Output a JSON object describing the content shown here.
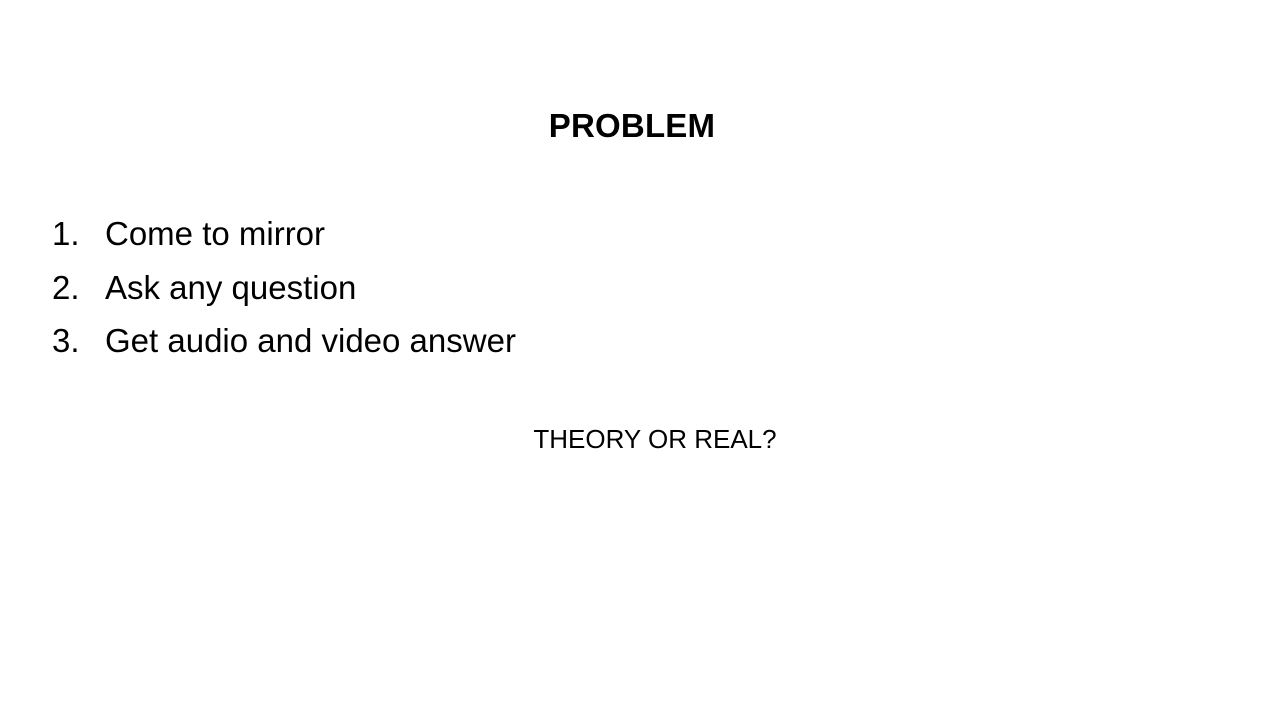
{
  "slide": {
    "title": "PROBLEM",
    "steps": [
      {
        "number": "1.",
        "text": "Come to mirror"
      },
      {
        "number": "2.",
        "text": "Ask any question"
      },
      {
        "number": "3.",
        "text": "Get audio and video answer"
      }
    ],
    "question": "THEORY OR REAL?"
  }
}
